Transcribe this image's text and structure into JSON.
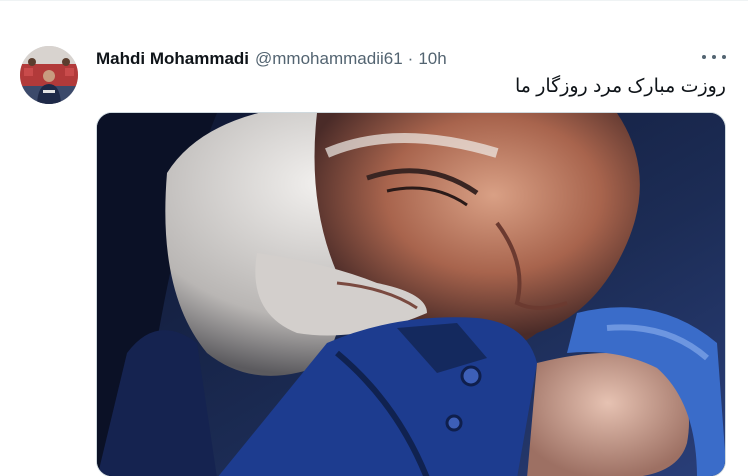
{
  "tweet": {
    "author_name": "Mahdi Mohammadi",
    "author_handle": "@mmohammadii61",
    "separator": "·",
    "timestamp": "10h",
    "text": "روزت مبارک مرد روزگار ما",
    "more_icon": "more-horizontal-icon",
    "colors": {
      "name": "#0f1419",
      "meta": "#536471",
      "border": "#cfd9de"
    }
  }
}
